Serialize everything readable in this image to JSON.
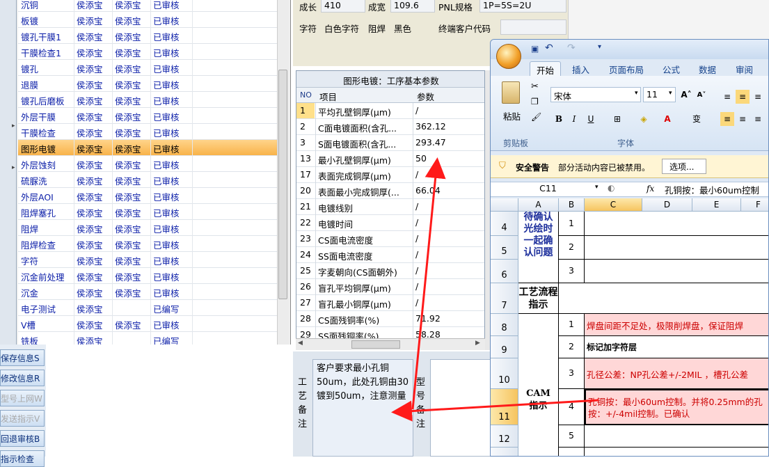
{
  "left_list": {
    "rows": [
      {
        "name": "沉铜",
        "c2": "侯添宝",
        "c3": "侯添宝",
        "status": "已审核"
      },
      {
        "name": "板镀",
        "c2": "侯添宝",
        "c3": "侯添宝",
        "status": "已审核"
      },
      {
        "name": "镀孔干膜1",
        "c2": "侯添宝",
        "c3": "侯添宝",
        "status": "已审核"
      },
      {
        "name": "干膜检查1",
        "c2": "侯添宝",
        "c3": "侯添宝",
        "status": "已审核"
      },
      {
        "name": "镀孔",
        "c2": "侯添宝",
        "c3": "侯添宝",
        "status": "已审核"
      },
      {
        "name": "退膜",
        "c2": "侯添宝",
        "c3": "侯添宝",
        "status": "已审核"
      },
      {
        "name": "镀孔后磨板",
        "c2": "侯添宝",
        "c3": "侯添宝",
        "status": "已审核"
      },
      {
        "name": "外层干膜",
        "c2": "侯添宝",
        "c3": "侯添宝",
        "status": "已审核"
      },
      {
        "name": "干膜检查",
        "c2": "侯添宝",
        "c3": "侯添宝",
        "status": "已审核"
      },
      {
        "name": "图形电镀",
        "c2": "侯添宝",
        "c3": "侯添宝",
        "status": "已审核",
        "selected": true
      },
      {
        "name": "外层蚀刻",
        "c2": "侯添宝",
        "c3": "侯添宝",
        "status": "已审核"
      },
      {
        "name": "硫脲洗",
        "c2": "侯添宝",
        "c3": "侯添宝",
        "status": "已审核"
      },
      {
        "name": "外层AOI",
        "c2": "侯添宝",
        "c3": "侯添宝",
        "status": "已审核"
      },
      {
        "name": "阻焊塞孔",
        "c2": "侯添宝",
        "c3": "侯添宝",
        "status": "已审核"
      },
      {
        "name": "阻焊",
        "c2": "侯添宝",
        "c3": "侯添宝",
        "status": "已审核"
      },
      {
        "name": "阻焊检查",
        "c2": "侯添宝",
        "c3": "侯添宝",
        "status": "已审核"
      },
      {
        "name": "字符",
        "c2": "侯添宝",
        "c3": "侯添宝",
        "status": "已审核"
      },
      {
        "name": "沉金前处理",
        "c2": "侯添宝",
        "c3": "侯添宝",
        "status": "已审核"
      },
      {
        "name": "沉金",
        "c2": "侯添宝",
        "c3": "侯添宝",
        "status": "已审核"
      },
      {
        "name": "电子测试",
        "c2": "侯添宝",
        "c3": "",
        "status": "已编写"
      },
      {
        "name": "V槽",
        "c2": "侯添宝",
        "c3": "侯添宝",
        "status": "已审核"
      },
      {
        "name": "铣板",
        "c2": "侯添宝",
        "c3": "",
        "status": "已编写"
      }
    ]
  },
  "left_buttons": [
    {
      "label": "保存信息S",
      "disabled": false
    },
    {
      "label": "修改信息R",
      "disabled": false
    },
    {
      "label": "型号上网W",
      "disabled": true
    },
    {
      "label": "发送指示V",
      "disabled": true
    },
    {
      "label": "回退审核B",
      "disabled": false
    },
    {
      "label": "指示检查",
      "disabled": false
    }
  ],
  "info": {
    "growth_label": "成长",
    "growth_value": "410",
    "width_label": "成宽",
    "width_value": "109.6",
    "pnl_label": "PNL规格",
    "pnl_value": "1P=5S=2U",
    "char_label": "字符",
    "char_value": "白色字符",
    "mask_label": "阻焊",
    "mask_value": "黑色",
    "customer_label": "终端客户代码",
    "customer_value": ""
  },
  "params": {
    "title": "图形电镀：工序基本参数",
    "col_no": "NO",
    "col_item": "项目",
    "col_param": "参数",
    "rows": [
      {
        "no": "1",
        "item": "平均孔壁铜厚(μm)",
        "param": "/"
      },
      {
        "no": "2",
        "item": "C面电镀面积(含孔...",
        "param": "362.12"
      },
      {
        "no": "3",
        "item": "S面电镀面积(含孔...",
        "param": "293.47"
      },
      {
        "no": "13",
        "item": "最小孔壁铜厚(μm)",
        "param": "50"
      },
      {
        "no": "17",
        "item": "表面完成铜厚(μm)",
        "param": "/"
      },
      {
        "no": "20",
        "item": "表面最小完成铜厚(...",
        "param": "66.04"
      },
      {
        "no": "21",
        "item": "电镀线别",
        "param": "/"
      },
      {
        "no": "22",
        "item": "电镀时间",
        "param": "/"
      },
      {
        "no": "23",
        "item": "CS面电流密度",
        "param": "/"
      },
      {
        "no": "24",
        "item": "SS面电流密度",
        "param": "/"
      },
      {
        "no": "25",
        "item": "字麦朝向(CS面朝外)",
        "param": "/"
      },
      {
        "no": "26",
        "item": "盲孔平均铜厚(μm)",
        "param": "/"
      },
      {
        "no": "27",
        "item": "盲孔最小铜厚(μm)",
        "param": "/"
      },
      {
        "no": "28",
        "item": "CS面残铜率(%)",
        "param": "71.92"
      },
      {
        "no": "29",
        "item": "SS面残铜率(%)",
        "param": "58.28"
      }
    ]
  },
  "remark": {
    "label": "工艺备注",
    "text": "客户要求最小孔铜50um，此处孔铜由30镀到50um，注意测量",
    "type_label": "型号备注"
  },
  "excel": {
    "tabs": [
      "开始",
      "插入",
      "页面布局",
      "公式",
      "数据",
      "审阅"
    ],
    "font_name": "宋体",
    "font_size": "11",
    "paste_label": "粘贴",
    "clipboard_label": "剪贴板",
    "font_group_label": "字体",
    "security_title": "安全警告",
    "security_text": "部分活动内容已被禁用。",
    "options_button": "选项...",
    "name_box": "C11",
    "fx": "fx",
    "formula": "孔铜按：最小60um控制",
    "columns": [
      "A",
      "B",
      "C",
      "D",
      "E",
      "F"
    ],
    "rows": [
      {
        "num": "4"
      },
      {
        "num": "5"
      },
      {
        "num": "6"
      },
      {
        "num": "7"
      },
      {
        "num": "8"
      },
      {
        "num": "9"
      },
      {
        "num": "10"
      },
      {
        "num": "11"
      },
      {
        "num": "12"
      }
    ],
    "a_confirm": "待确认光绘时一起确认问题",
    "a_flow": "工艺流程指示",
    "a_cam": "CAM指示",
    "b_vals": [
      "1",
      "2",
      "3"
    ],
    "cam_items": [
      {
        "num": "1",
        "text": "焊盘间距不足处，极限削焊盘，保证阻焊"
      },
      {
        "num": "2",
        "text": "标记加字符层"
      },
      {
        "num": "3",
        "text": "孔径公差：NP孔公差+/-2MIL ，槽孔公差"
      },
      {
        "num": "4",
        "text": "孔铜按：最小60um控制。并将0.25mm的孔",
        "text2": "按：+/-4mil控制。已确认"
      },
      {
        "num": "5",
        "text": ""
      }
    ]
  },
  "colors": {
    "arrow": "#ff1a1a",
    "selected_row": "#f8b34a",
    "pink_cell": "#ffd7d7"
  }
}
